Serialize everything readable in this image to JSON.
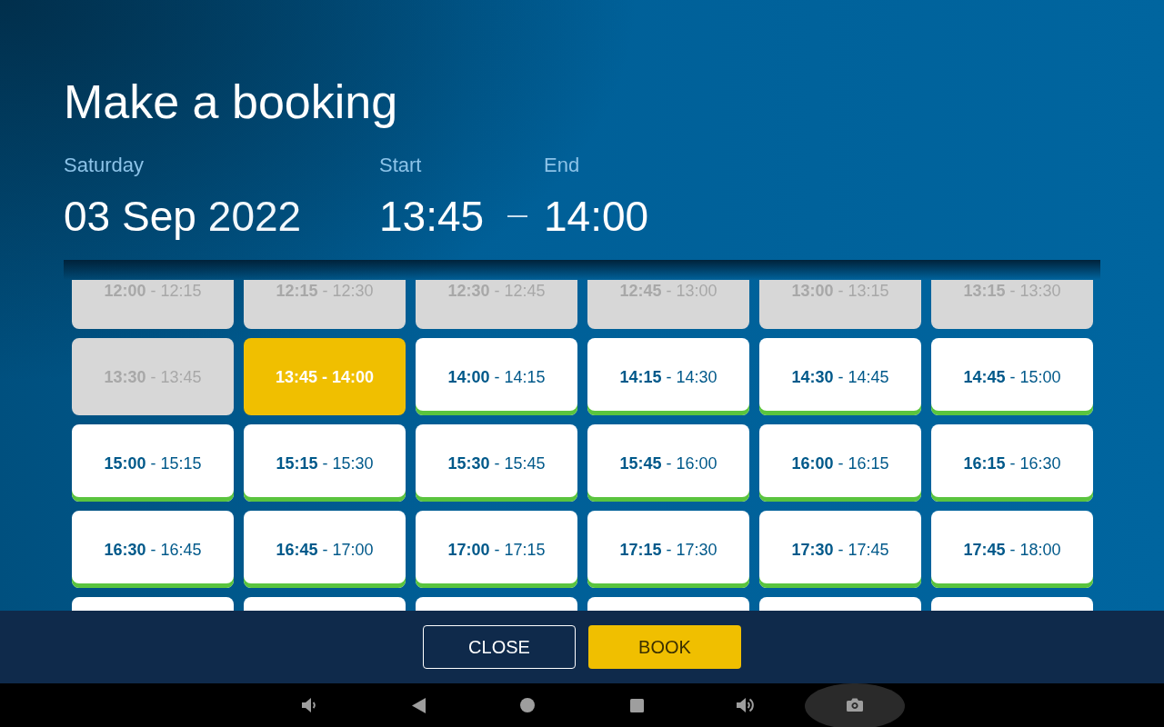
{
  "title": "Make a booking",
  "booking": {
    "day_label": "Saturday",
    "date": "03 Sep",
    "year": "2022",
    "start_label": "Start",
    "start": "13:45",
    "end_label": "End",
    "end": "14:00"
  },
  "slots": [
    {
      "label": "**12:00** - 12:15",
      "available": false,
      "selected": false
    },
    {
      "label": "**12:15** - 12:30",
      "available": false,
      "selected": false
    },
    {
      "label": "**12:30** - 12:45",
      "available": false,
      "selected": false
    },
    {
      "label": "**12:45** - 13:00",
      "available": false,
      "selected": false
    },
    {
      "label": "**13:00** - 13:15",
      "available": false,
      "selected": false
    },
    {
      "label": "**13:15** - 13:30",
      "available": false,
      "selected": false
    },
    {
      "label": "**13:30** - 13:45",
      "available": false,
      "selected": false
    },
    {
      "label": "13:45 - 14:00",
      "available": true,
      "selected": true
    },
    {
      "label": "**14:00** - 14:15",
      "available": true,
      "selected": false
    },
    {
      "label": "**14:15** - 14:30",
      "available": true,
      "selected": false
    },
    {
      "label": "**14:30** - 14:45",
      "available": true,
      "selected": false
    },
    {
      "label": "**14:45** - 15:00",
      "available": true,
      "selected": false
    },
    {
      "label": "**15:00** - 15:15",
      "available": true,
      "selected": false
    },
    {
      "label": "**15:15** - 15:30",
      "available": true,
      "selected": false
    },
    {
      "label": "**15:30** - 15:45",
      "available": true,
      "selected": false
    },
    {
      "label": "**15:45** - 16:00",
      "available": true,
      "selected": false
    },
    {
      "label": "**16:00** - 16:15",
      "available": true,
      "selected": false
    },
    {
      "label": "**16:15** - 16:30",
      "available": true,
      "selected": false
    },
    {
      "label": "**16:30** - 16:45",
      "available": true,
      "selected": false
    },
    {
      "label": "**16:45** - 17:00",
      "available": true,
      "selected": false
    },
    {
      "label": "**17:00** - 17:15",
      "available": true,
      "selected": false
    },
    {
      "label": "**17:15** - 17:30",
      "available": true,
      "selected": false
    },
    {
      "label": "**17:30** - 17:45",
      "available": true,
      "selected": false
    },
    {
      "label": "**17:45** - 18:00",
      "available": true,
      "selected": false
    },
    {
      "available": true,
      "selected": false
    },
    {
      "available": true,
      "selected": false
    },
    {
      "available": true,
      "selected": false
    },
    {
      "available": true,
      "selected": false
    },
    {
      "available": true,
      "selected": false
    },
    {
      "available": true,
      "selected": false
    }
  ],
  "buttons": [
    {
      "label": "CLOSE",
      "kind": "outline"
    },
    {
      "label": "BOOK",
      "kind": "primary"
    }
  ]
}
